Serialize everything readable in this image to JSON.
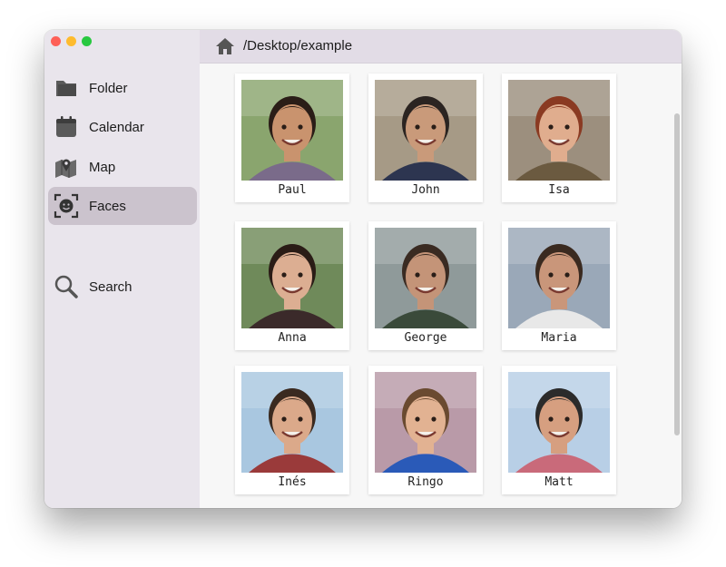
{
  "sidebar": {
    "items": [
      {
        "label": "Folder",
        "icon": "folder-icon"
      },
      {
        "label": "Calendar",
        "icon": "calendar-icon"
      },
      {
        "label": "Map",
        "icon": "map-icon"
      },
      {
        "label": "Faces",
        "icon": "face-scan-icon",
        "active": true
      },
      {
        "label": "Search",
        "icon": "search-icon"
      }
    ]
  },
  "header": {
    "path": "/Desktop/example",
    "home_icon": "home-icon"
  },
  "faces": [
    {
      "name": "Paul",
      "bg": "#8aa56e",
      "skin": "#c9936e",
      "hair": "#2a1d17",
      "shirt": "#7a6b8a"
    },
    {
      "name": "John",
      "bg": "#a69a86",
      "skin": "#c99a7a",
      "hair": "#2b2421",
      "shirt": "#2d3550"
    },
    {
      "name": "Isa",
      "bg": "#9c8f7e",
      "skin": "#e0ad8e",
      "hair": "#8a3a22",
      "shirt": "#6b5a40"
    },
    {
      "name": "Anna",
      "bg": "#6f8a5a",
      "skin": "#dcae92",
      "hair": "#2a1c16",
      "shirt": "#3b2a2a"
    },
    {
      "name": "George",
      "bg": "#8f9a9a",
      "skin": "#c49478",
      "hair": "#3a2b22",
      "shirt": "#3a4a3a"
    },
    {
      "name": "Maria",
      "bg": "#9aa8b8",
      "skin": "#c9967a",
      "hair": "#3a2a20",
      "shirt": "#e8e8e8"
    },
    {
      "name": "Inés",
      "bg": "#a9c7e0",
      "skin": "#dba98a",
      "hair": "#3a2a20",
      "shirt": "#9a3a3a"
    },
    {
      "name": "Ringo",
      "bg": "#b99aa8",
      "skin": "#e2b292",
      "hair": "#6a4a30",
      "shirt": "#2a5ab8"
    },
    {
      "name": "Matt",
      "bg": "#b8cfe6",
      "skin": "#d69f80",
      "hair": "#2b2b2b",
      "shirt": "#c96a7a"
    }
  ]
}
